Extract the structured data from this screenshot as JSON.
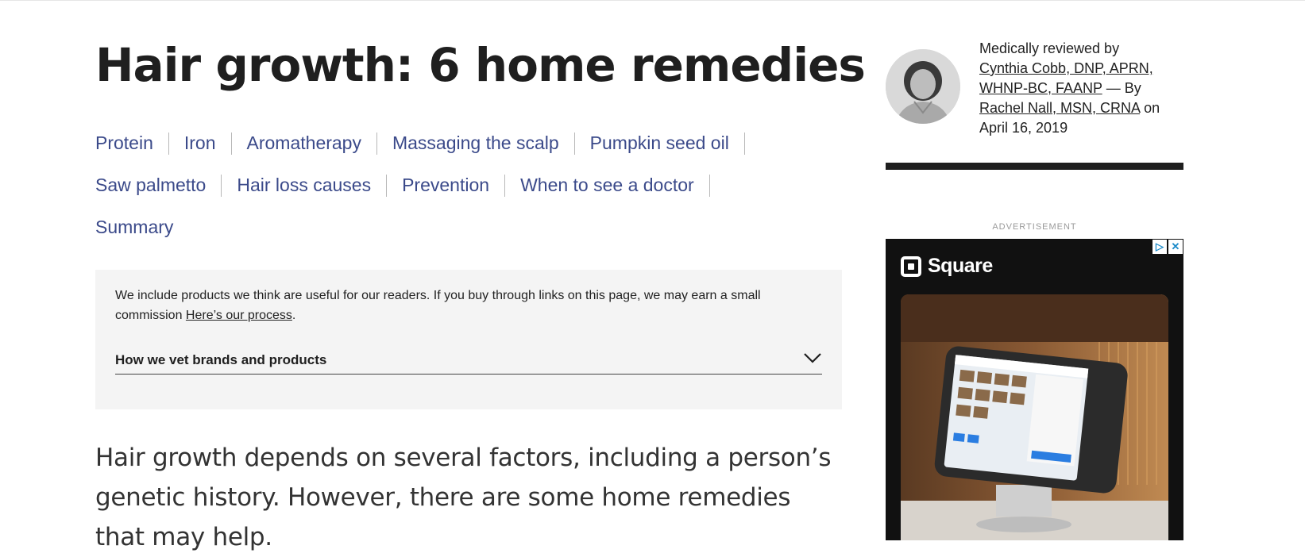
{
  "article": {
    "title": "Hair growth: 6 home remedies",
    "toc": [
      [
        "Protein",
        "Iron",
        "Aromatherapy",
        "Massaging the scalp",
        "Pumpkin seed oil"
      ],
      [
        "Saw palmetto",
        "Hair loss causes",
        "Prevention",
        "When to see a doctor"
      ],
      [
        "Summary"
      ]
    ],
    "disclosure": {
      "text": "We include products we think are useful for our readers. If you buy through links on this page, we may earn a small commission",
      "link": "Here’s our process",
      "suffix": ".",
      "vet_label": "How we vet brands and products"
    },
    "intro": "Hair growth depends on several factors, including a person’s genetic history. However, there are some home remedies that may help."
  },
  "review": {
    "prefix": "Medically reviewed by",
    "reviewer": "Cynthia Cobb, DNP, APRN, WHNP-BC, FAANP",
    "by": " — By ",
    "author": "Rachel Nall, MSN, CRNA",
    "on": " on ",
    "date": "April 16, 2019"
  },
  "ad": {
    "label": "ADVERTISEMENT",
    "brand": "Square",
    "choices_icons": [
      "adchoices-icon",
      "close-icon"
    ]
  },
  "colors": {
    "link": "#3b4a8a",
    "text": "#1f1f1f",
    "panel": "#f4f4f4"
  }
}
